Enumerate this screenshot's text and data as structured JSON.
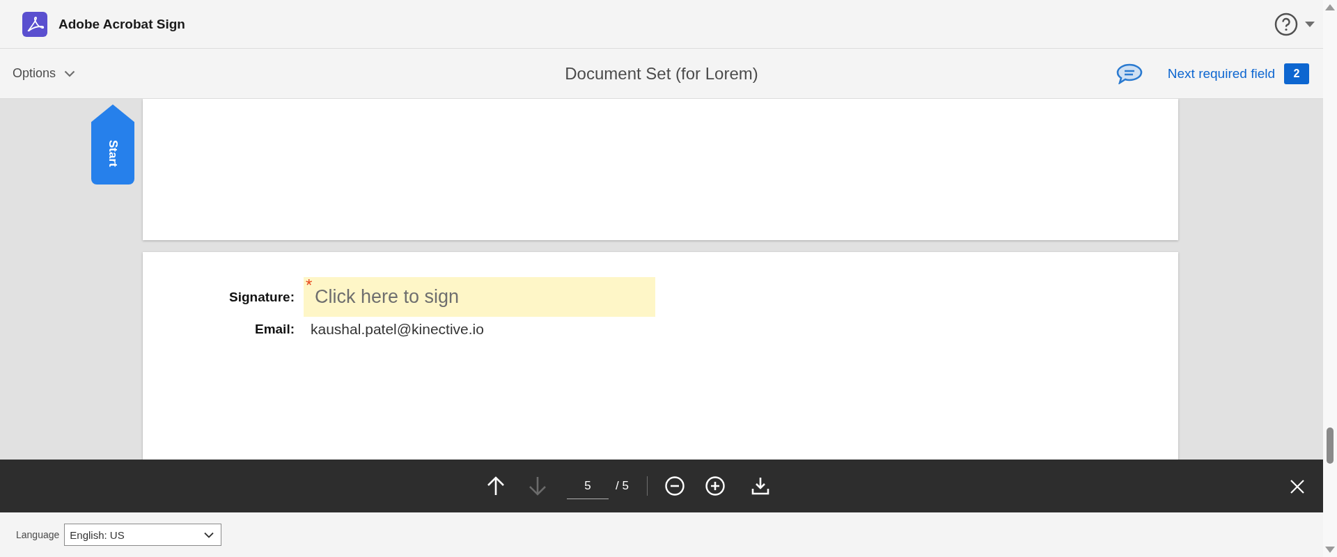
{
  "app": {
    "name": "Adobe Acrobat Sign"
  },
  "subbar": {
    "options_label": "Options",
    "document_title": "Document Set (for Lorem)",
    "next_field_label": "Next required field",
    "required_count": "2"
  },
  "start_tab": {
    "label": "Start"
  },
  "form": {
    "fields": [
      {
        "kind": "signature",
        "label": "Signature:",
        "placeholder": "Click here to sign",
        "required_mark": "*"
      },
      {
        "kind": "text",
        "label": "Email:",
        "value": "kaushal.patel@kinective.io"
      }
    ]
  },
  "pager": {
    "current_page": "5",
    "total": "/ 5",
    "previous": {
      "disabled": false
    },
    "next": {
      "disabled": true
    }
  },
  "footer": {
    "language_label": "Language",
    "language": "English: US"
  }
}
